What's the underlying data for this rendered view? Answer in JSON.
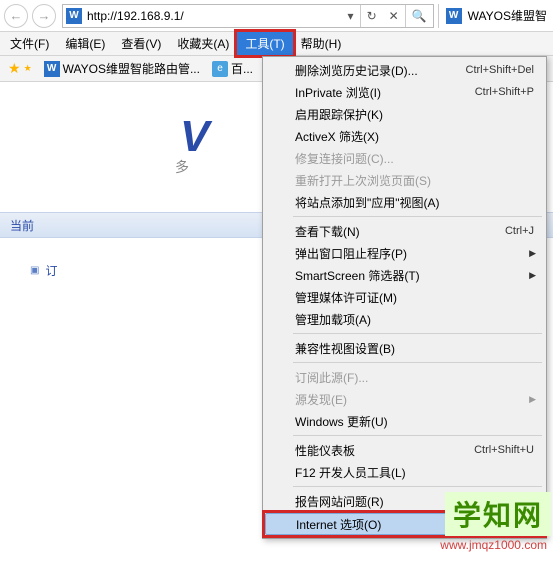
{
  "nav": {
    "url": "http://192.168.9.1/",
    "page_title": "WAYOS维盟智",
    "page_icon_letter": "W"
  },
  "menu": {
    "file": "文件(F)",
    "edit": "编辑(E)",
    "view": "查看(V)",
    "favorites": "收藏夹(A)",
    "tools": "工具(T)",
    "help": "帮助(H)"
  },
  "favbar": {
    "item1": "WAYOS维盟智能路由管...",
    "item2": "百..."
  },
  "page": {
    "tagline_left": "多",
    "tab_label": "当前",
    "panel_item": "订"
  },
  "tools_menu": {
    "delete_history": "删除浏览历史记录(D)...",
    "delete_history_sc": "Ctrl+Shift+Del",
    "inprivate": "InPrivate 浏览(I)",
    "inprivate_sc": "Ctrl+Shift+P",
    "tracking": "启用跟踪保护(K)",
    "activex": "ActiveX 筛选(X)",
    "fix_conn": "修复连接问题(C)...",
    "reopen": "重新打开上次浏览页面(S)",
    "add_site": "将站点添加到\"应用\"视图(A)",
    "downloads": "查看下载(N)",
    "downloads_sc": "Ctrl+J",
    "popup": "弹出窗口阻止程序(P)",
    "smartscreen": "SmartScreen 筛选器(T)",
    "media": "管理媒体许可证(M)",
    "addons": "管理加载项(A)",
    "compat": "兼容性视图设置(B)",
    "feed_sub": "订阅此源(F)...",
    "feed_find": "源发现(E)",
    "win_update": "Windows 更新(U)",
    "perf": "性能仪表板",
    "perf_sc": "Ctrl+Shift+U",
    "devtools": "F12 开发人员工具(L)",
    "report": "报告网站问题(R)",
    "internet_options": "Internet 选项(O)"
  },
  "watermark": {
    "text": "学知网",
    "url": "www.jmqz1000.com"
  }
}
